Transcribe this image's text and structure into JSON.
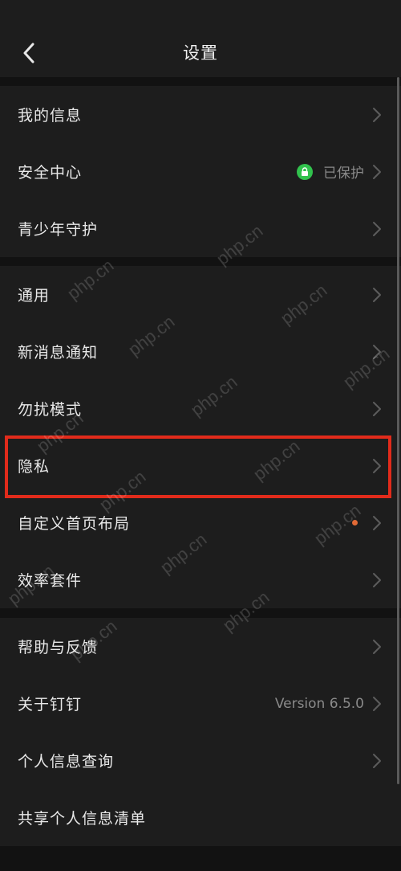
{
  "header": {
    "title": "设置",
    "back_icon": "chevron-left-icon"
  },
  "groups": [
    {
      "items": [
        {
          "label": "我的信息"
        },
        {
          "label": "安全中心",
          "status": "已保护",
          "status_icon": "lock-icon",
          "status_color": "#31c24d"
        },
        {
          "label": "青少年守护"
        }
      ]
    },
    {
      "items": [
        {
          "label": "通用"
        },
        {
          "label": "新消息通知"
        },
        {
          "label": "勿扰模式"
        },
        {
          "label": "隐私"
        },
        {
          "label": "自定义首页布局",
          "badge": "dot",
          "badge_color": "#e26a36"
        },
        {
          "label": "效率套件"
        }
      ]
    },
    {
      "items": [
        {
          "label": "帮助与反馈"
        },
        {
          "label": "关于钉钉",
          "value": "Version 6.5.0"
        },
        {
          "label": "个人信息查询"
        },
        {
          "label": "共享个人信息清单"
        }
      ]
    }
  ],
  "highlight": {
    "target": "隐私",
    "color": "#e12b1b"
  },
  "watermark": "php.cn"
}
